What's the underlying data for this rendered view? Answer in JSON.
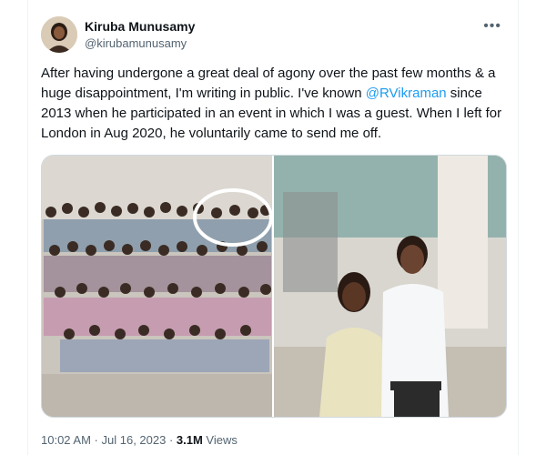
{
  "user": {
    "name": "Kiruba Munusamy",
    "handle": "@kirubamunusamy"
  },
  "menu_icon": "more-horizontal-icon",
  "tweet": {
    "text_1": "After having undergone a great deal of agony over the past few months & a huge disappointment, I'm writing in public. I've known ",
    "mention": "@RVikraman",
    "text_2": " since 2013 when he participated in an event in which I was a guest. When I left for London in Aug 2020, he voluntarily came to send me off."
  },
  "footer": {
    "time": "10:02 AM",
    "sep1": " · ",
    "date": "Jul 16, 2023",
    "sep2": " · ",
    "views_count": "3.1M",
    "views_label": " Views"
  }
}
